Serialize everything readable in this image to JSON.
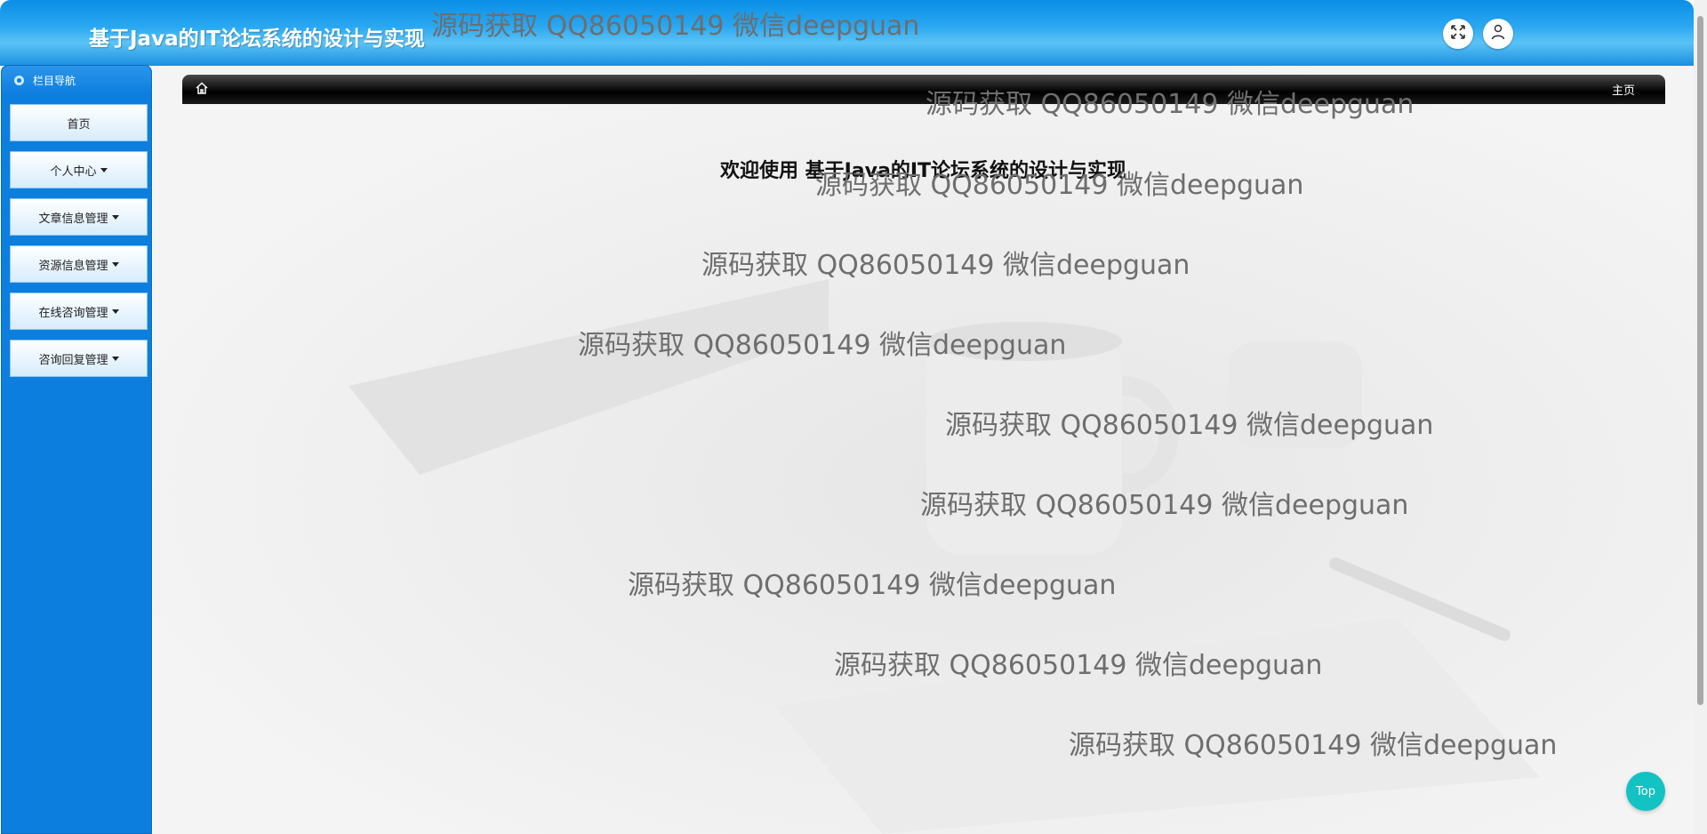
{
  "header": {
    "title": "基于Java的IT论坛系统的设计与实现",
    "fullscreen_icon": "fullscreen-icon",
    "user_icon": "user-icon"
  },
  "sidebar": {
    "heading": "栏目导航",
    "items": [
      {
        "label": "首页",
        "dropdown": false
      },
      {
        "label": "个人中心",
        "dropdown": true
      },
      {
        "label": "文章信息管理",
        "dropdown": true
      },
      {
        "label": "资源信息管理",
        "dropdown": true
      },
      {
        "label": "在线咨询管理",
        "dropdown": true
      },
      {
        "label": "咨询回复管理",
        "dropdown": true
      }
    ]
  },
  "breadcrumb": {
    "home_icon": "home-icon",
    "current": "主页"
  },
  "main": {
    "welcome": "欢迎使用 基于Java的IT论坛系统的设计与实现"
  },
  "watermark": {
    "text": "源码获取 QQ86050149 微信deepguan"
  },
  "back_to_top": "Top",
  "colors": {
    "header": "#2aa7f0",
    "sidebar": "#0c7ede",
    "breadcrumb": "#000000",
    "top_button": "#13c2c2"
  }
}
